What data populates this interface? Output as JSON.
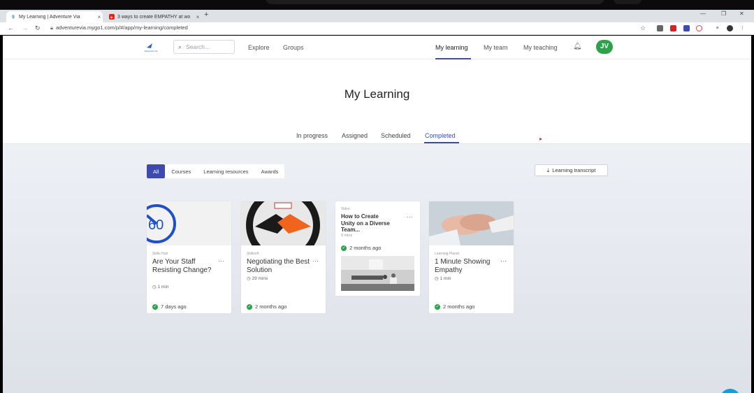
{
  "browser": {
    "tabs": [
      {
        "title": "My Learning | Adventure Via",
        "favicon": "go1-icon"
      },
      {
        "title": "3 ways to create EMPATHY at wo",
        "favicon": "youtube-icon"
      }
    ],
    "close_glyph": "×",
    "new_tab_glyph": "+",
    "url": "adventurevia.mygo1.com/p/#/app/my-learning/completed"
  },
  "header": {
    "search_placeholder": "Search...",
    "left_links": [
      "Explore",
      "Groups"
    ],
    "right_links": [
      "My learning",
      "My team",
      "My teaching"
    ],
    "avatar_initials": "JV",
    "logo_text": "Adventure Via"
  },
  "page": {
    "title": "My Learning",
    "tabs": [
      "In progress",
      "Assigned",
      "Scheduled",
      "Completed"
    ],
    "active_tab": "Completed"
  },
  "filters": {
    "items": [
      "All",
      "Courses",
      "Learning resources",
      "Awards"
    ],
    "active": "All",
    "transcript_label": "Learning transcript"
  },
  "cards": [
    {
      "provider": "Skills Hub",
      "title": "Are Your Staff Resisting Change?",
      "duration": "1 min",
      "completed": "7 days ago",
      "thumb_text": "60"
    },
    {
      "provider": "Skillsoft",
      "title": "Negotiating the Best Solution",
      "duration": "29 mins",
      "completed": "2 months ago"
    },
    {
      "provider": "Video",
      "title": "How to Create Unity on a Diverse Team...",
      "duration": "9 mins",
      "completed": "2 months ago"
    },
    {
      "provider": "Learning Planet",
      "title": "1 Minute Showing Empathy",
      "duration": "1 min",
      "completed": "2 months ago"
    }
  ],
  "colors": {
    "accent": "#3d4bb0",
    "success": "#2ca34b"
  }
}
